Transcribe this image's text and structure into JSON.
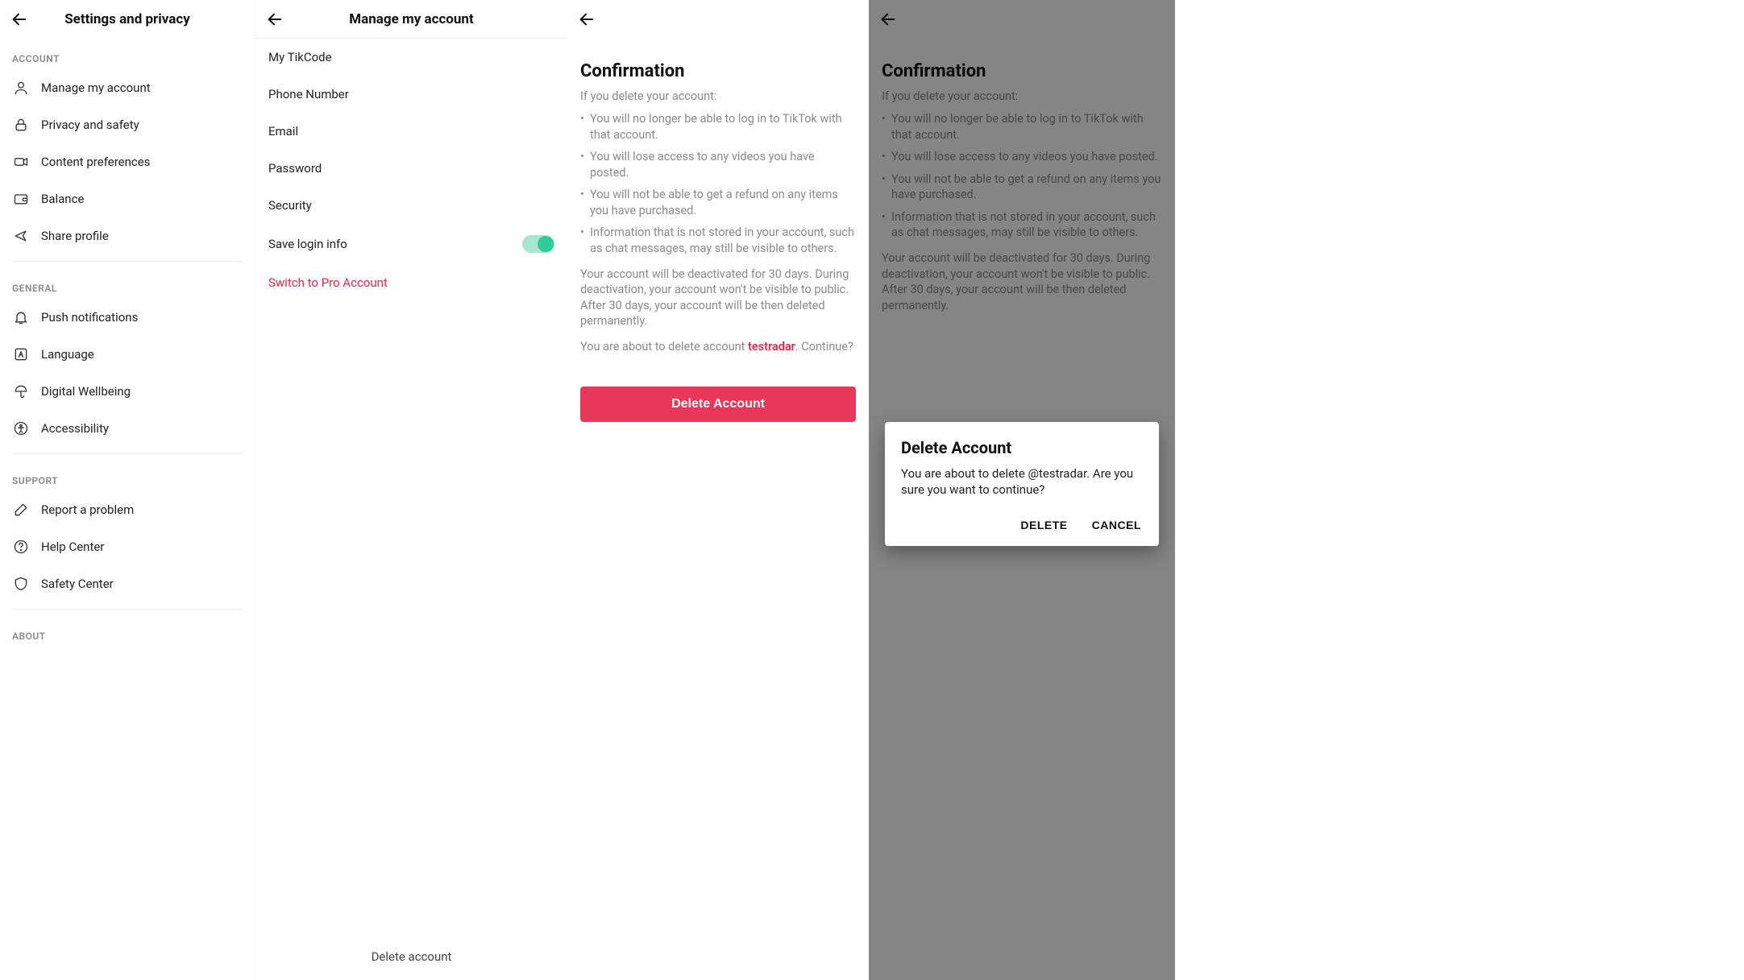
{
  "panel1": {
    "title": "Settings and privacy",
    "sections": [
      {
        "label": "ACCOUNT",
        "items": [
          {
            "label": "Manage my account"
          },
          {
            "label": "Privacy and safety"
          },
          {
            "label": "Content preferences"
          },
          {
            "label": "Balance"
          },
          {
            "label": "Share profile"
          }
        ]
      },
      {
        "label": "GENERAL",
        "items": [
          {
            "label": "Push notifications"
          },
          {
            "label": "Language"
          },
          {
            "label": "Digital Wellbeing"
          },
          {
            "label": "Accessibility"
          }
        ]
      },
      {
        "label": "SUPPORT",
        "items": [
          {
            "label": "Report a problem"
          },
          {
            "label": "Help Center"
          },
          {
            "label": "Safety Center"
          }
        ]
      },
      {
        "label": "ABOUT",
        "items": []
      }
    ]
  },
  "panel2": {
    "title": "Manage my account",
    "items": [
      {
        "label": "My TikCode"
      },
      {
        "label": "Phone Number"
      },
      {
        "label": "Email"
      },
      {
        "label": "Password"
      },
      {
        "label": "Security"
      },
      {
        "label": "Save login info",
        "toggle": true
      }
    ],
    "switch_link": "Switch to Pro Account",
    "delete_label": "Delete account"
  },
  "confirmation": {
    "title": "Confirmation",
    "intro": "If you delete your account:",
    "bullets": [
      "You will no longer be able to log in to TikTok with that account.",
      "You will lose access to any videos you have posted.",
      "You will not be able to get a refund on any items you have purchased.",
      "Information that is not stored in your account, such as chat messages, may still be visible to others."
    ],
    "deactivate_para": "Your account will be deactivated for 30 days. During deactivation, your account won't be visible to public. After 30 days, your account will be then deleted permanently.",
    "question_prefix": "You are about to delete account ",
    "username": "testradar",
    "question_suffix": ". Continue?",
    "delete_button": "Delete Account"
  },
  "dialog": {
    "title": "Delete Account",
    "body": "You are about to delete @testradar. Are you sure you want to continue?",
    "delete": "DELETE",
    "cancel": "CANCEL"
  }
}
